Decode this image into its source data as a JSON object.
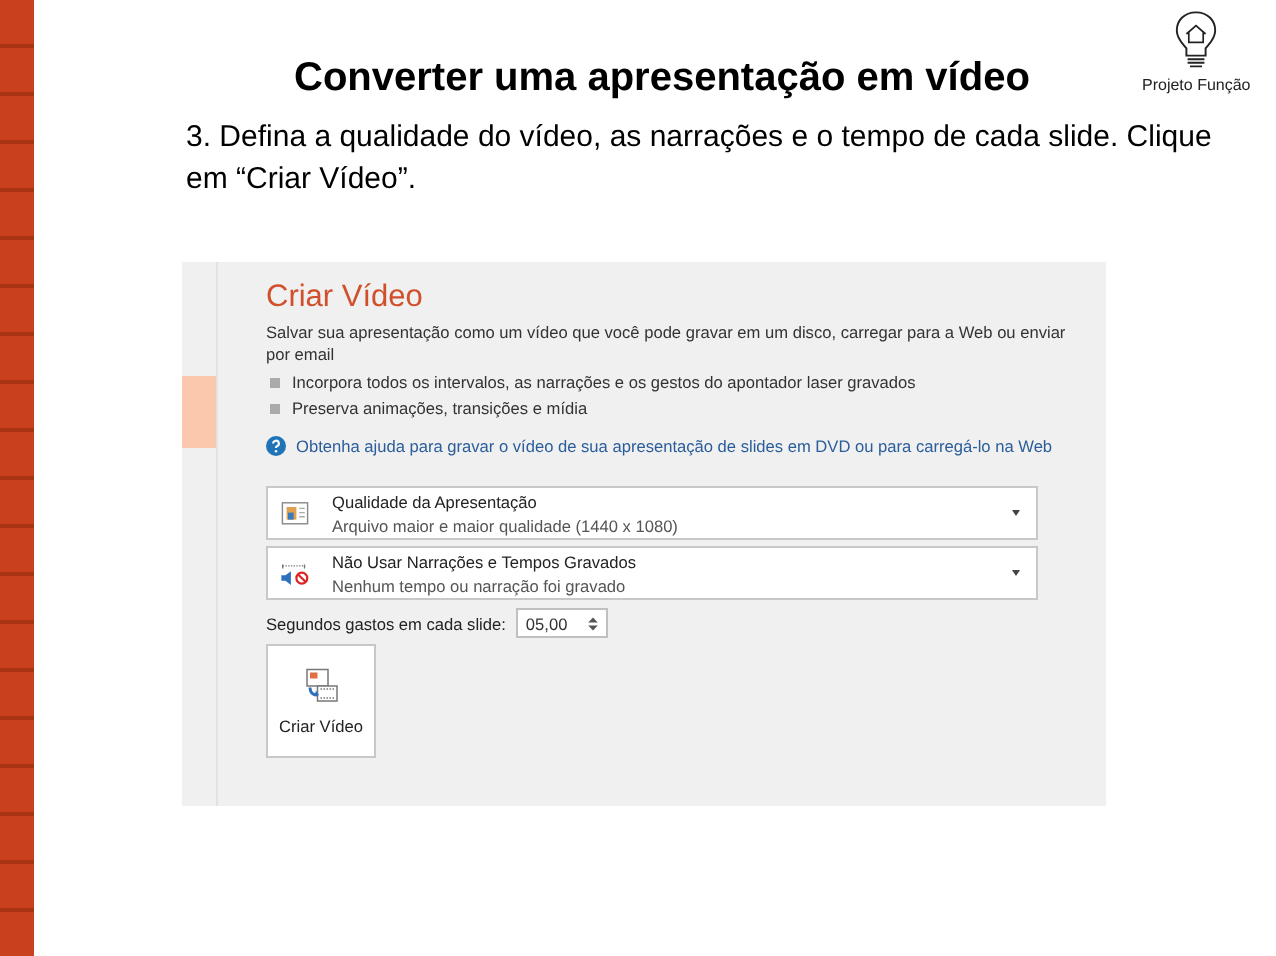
{
  "slide": {
    "title": "Converter uma apresentação em vídeo",
    "instruction": "3. Defina a qualidade do vídeo, as narrações e o tempo de cada slide. Clique em “Criar Vídeo”.",
    "logo_caption": "Projeto Função"
  },
  "panel": {
    "heading": "Criar Vídeo",
    "description": "Salvar sua apresentação como um vídeo que você pode gravar em um disco, carregar para a Web ou enviar por email",
    "bullets": [
      "Incorpora todos os intervalos, as narrações e os gestos do apontador laser gravados",
      "Preserva animações, transições e mídia"
    ],
    "help_link": "Obtenha ajuda para gravar o vídeo de sua apresentação de slides em DVD ou para carregá-lo na Web",
    "dropdowns": [
      {
        "kind": "quality",
        "title": "Qualidade da Apresentação",
        "subtitle": "Arquivo maior e maior qualidade (1440 x 1080)"
      },
      {
        "kind": "narration",
        "title": "Não Usar Narrações e Tempos Gravados",
        "subtitle": "Nenhum tempo ou narração foi gravado"
      }
    ],
    "seconds_label": "Segundos gastos em cada slide:",
    "seconds_value": "05,00",
    "create_button": "Criar Vídeo"
  }
}
